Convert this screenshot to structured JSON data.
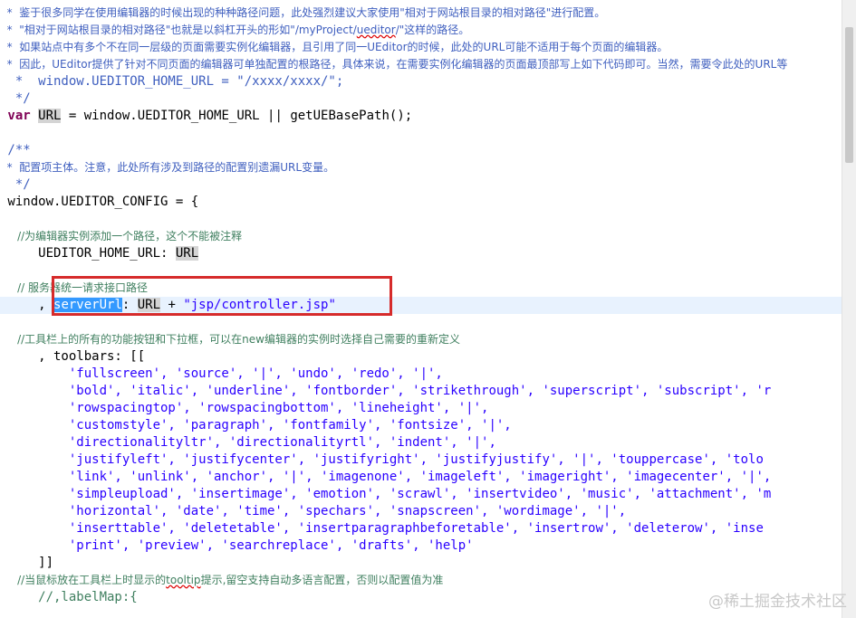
{
  "lines": [
    {
      "segments": [
        {
          "cls": "cj",
          "text": "  *  鉴于很多同学在使用编辑器的时候出现的种种路径问题，此处强烈建议大家使用\"相对于网站根目录的相对路径\"进行配置。"
        }
      ]
    },
    {
      "segments": [
        {
          "cls": "cj",
          "text": "  *  \"相对于网站根目录的相对路径\"也就是以斜杠开头的形如\""
        },
        {
          "cls": "cj",
          "text": "/myProject/"
        },
        {
          "cls": "cj ul",
          "text": "ueditor"
        },
        {
          "cls": "cj",
          "text": "/\"这样的路径。"
        }
      ]
    },
    {
      "segments": [
        {
          "cls": "cj",
          "text": "  *  如果站点中有多个不在同一层级的页面需要实例化编辑器，且引用了同一UEditor的时候，此处的URL可能不适用于每个页面的编辑器。"
        }
      ]
    },
    {
      "segments": [
        {
          "cls": "cj",
          "text": "  *  因此，UEditor提供了针对不同页面的编辑器可单独配置的根路径，具体来说，在需要实例化编辑器的页面最顶部写上如下代码即可。当然，需要令此处的URL等"
        }
      ]
    },
    {
      "segments": [
        {
          "cls": "cj",
          "text": "  *  window.UEDITOR_HOME_URL = \"/xxxx/xxxx/\";"
        }
      ]
    },
    {
      "segments": [
        {
          "cls": "cj",
          "text": "  */"
        }
      ]
    },
    {
      "segments": [
        {
          "cls": "kw",
          "text": " var"
        },
        {
          "cls": "",
          "text": " "
        },
        {
          "cls": "hl-var",
          "text": "URL"
        },
        {
          "cls": "",
          "text": " = window.UEDITOR_HOME_URL || getUEBasePath();"
        }
      ]
    },
    {
      "segments": [
        {
          "cls": "",
          "text": ""
        }
      ]
    },
    {
      "segments": [
        {
          "cls": "cj",
          "text": " /**"
        }
      ]
    },
    {
      "segments": [
        {
          "cls": "cj",
          "text": "  *  配置项主体。注意，此处所有涉及到路径的配置别遗漏URL变量。"
        }
      ]
    },
    {
      "segments": [
        {
          "cls": "cj",
          "text": "  */"
        }
      ]
    },
    {
      "segments": [
        {
          "cls": "",
          "text": " window.UEDITOR_CONFIG = {"
        }
      ]
    },
    {
      "segments": [
        {
          "cls": "",
          "text": ""
        }
      ]
    },
    {
      "segments": [
        {
          "cls": "c",
          "text": "     //为编辑器实例添加一个路径，这个不能被注释"
        }
      ]
    },
    {
      "segments": [
        {
          "cls": "",
          "text": "     UEDITOR_HOME_URL: "
        },
        {
          "cls": "hl-var",
          "text": "URL"
        }
      ]
    },
    {
      "segments": [
        {
          "cls": "",
          "text": ""
        }
      ]
    },
    {
      "segments": [
        {
          "cls": "c",
          "text": "     // 服务器统一请求接口路径"
        }
      ]
    },
    {
      "cur": true,
      "segments": [
        {
          "cls": "",
          "text": "     , "
        },
        {
          "cls": "hl-sel",
          "text": "serverUrl"
        },
        {
          "cls": "",
          "text": ": "
        },
        {
          "cls": "hl-sel2",
          "text": "URL"
        },
        {
          "cls": "",
          "text": " + "
        },
        {
          "cls": "str",
          "text": "\"jsp/controller.jsp\""
        }
      ]
    },
    {
      "segments": [
        {
          "cls": "",
          "text": ""
        }
      ]
    },
    {
      "segments": [
        {
          "cls": "c",
          "text": "     //工具栏上的所有的功能按钮和下拉框，可以在new编辑器的实例时选择自己需要的重新定义"
        }
      ]
    },
    {
      "segments": [
        {
          "cls": "",
          "text": "     , toolbars: [["
        }
      ]
    },
    {
      "segments": [
        {
          "cls": "str",
          "text": "         'fullscreen', 'source', '|', 'undo', 'redo', '|',"
        }
      ]
    },
    {
      "segments": [
        {
          "cls": "str",
          "text": "         'bold', 'italic', 'underline', 'fontborder', 'strikethrough', 'superscript', 'subscript', 'r"
        }
      ]
    },
    {
      "segments": [
        {
          "cls": "str",
          "text": "         'rowspacingtop', 'rowspacingbottom', 'lineheight', '|',"
        }
      ]
    },
    {
      "segments": [
        {
          "cls": "str",
          "text": "         'customstyle', 'paragraph', 'fontfamily', 'fontsize', '|',"
        }
      ]
    },
    {
      "segments": [
        {
          "cls": "str",
          "text": "         'directionalityltr', 'directionalityrtl', 'indent', '|',"
        }
      ]
    },
    {
      "segments": [
        {
          "cls": "str",
          "text": "         'justifyleft', 'justifycenter', 'justifyright', 'justifyjustify', '|', 'touppercase', 'tolo"
        }
      ]
    },
    {
      "segments": [
        {
          "cls": "str",
          "text": "         'link', 'unlink', 'anchor', '|', 'imagenone', 'imageleft', 'imageright', 'imagecenter', '|',"
        }
      ]
    },
    {
      "segments": [
        {
          "cls": "str",
          "text": "         'simpleupload', 'insertimage', 'emotion', 'scrawl', 'insertvideo', 'music', 'attachment', 'm"
        }
      ]
    },
    {
      "segments": [
        {
          "cls": "str",
          "text": "         'horizontal', 'date', 'time', 'spechars', 'snapscreen', 'wordimage', '|',"
        }
      ]
    },
    {
      "segments": [
        {
          "cls": "str",
          "text": "         'inserttable', 'deletetable', 'insertparagraphbeforetable', 'insertrow', 'deleterow', 'inse"
        }
      ]
    },
    {
      "segments": [
        {
          "cls": "str",
          "text": "         'print', 'preview', 'searchreplace', 'drafts', 'help'"
        }
      ]
    },
    {
      "segments": [
        {
          "cls": "",
          "text": "     ]]"
        }
      ]
    },
    {
      "segments": [
        {
          "cls": "c",
          "text": "     //当鼠标放在工具栏上时显示的"
        },
        {
          "cls": "c ul",
          "text": "tooltip"
        },
        {
          "cls": "c",
          "text": "提示,留空支持自动多语言配置，否则以配置值为准"
        }
      ]
    },
    {
      "segments": [
        {
          "cls": "c",
          "text": "     //,labelMap:{"
        }
      ]
    }
  ],
  "watermark": "@稀土掘金技术社区"
}
